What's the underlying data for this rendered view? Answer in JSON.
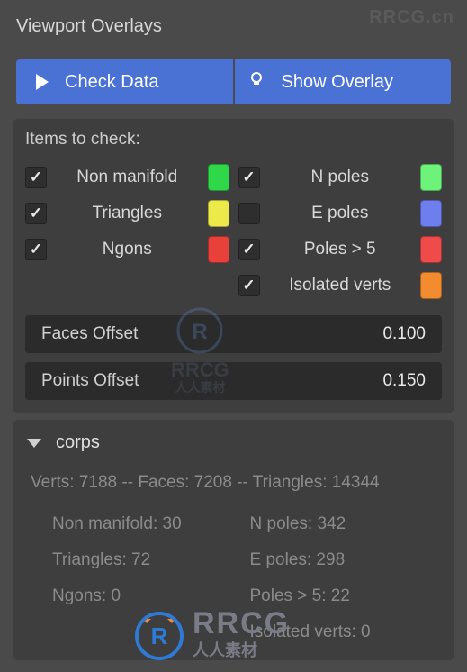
{
  "watermark_top": "RRCG.cn",
  "panel_title": "Viewport Overlays",
  "buttons": {
    "check_data": "Check Data",
    "show_overlay": "Show Overlay"
  },
  "items_section": {
    "label": "Items to check:",
    "checks": [
      {
        "label": "Non manifold",
        "checked": true,
        "color": "#2fd849"
      },
      {
        "label": "N poles",
        "checked": true,
        "color": "#6df27a"
      },
      {
        "label": "Triangles",
        "checked": true,
        "color": "#ecea4a"
      },
      {
        "label": "E poles",
        "checked": false,
        "color": "#6f7eee"
      },
      {
        "label": "Ngons",
        "checked": true,
        "color": "#e8413b"
      },
      {
        "label": "Poles > 5",
        "checked": true,
        "color": "#f04b4b"
      },
      {
        "label": "",
        "checked": false,
        "color": "",
        "empty": true
      },
      {
        "label": "Isolated verts",
        "checked": true,
        "color": "#f28c2e"
      }
    ],
    "offsets": {
      "faces_label": "Faces Offset",
      "faces_value": "0.100",
      "points_label": "Points Offset",
      "points_value": "0.150"
    }
  },
  "stats": {
    "object_name": "corps",
    "summary": "Verts: 7188 -- Faces: 7208 -- Triangles: 14344",
    "items": [
      "Non manifold: 30",
      "N poles: 342",
      "Triangles: 72",
      "E poles: 298",
      "Ngons: 0",
      "Poles > 5: 22",
      "",
      "Isolated verts: 0"
    ]
  },
  "wm_center": {
    "line1": "RRCG",
    "line2": "人人素材"
  },
  "wm_bottom": {
    "line1": "RRCG",
    "line2": "人人素材"
  }
}
